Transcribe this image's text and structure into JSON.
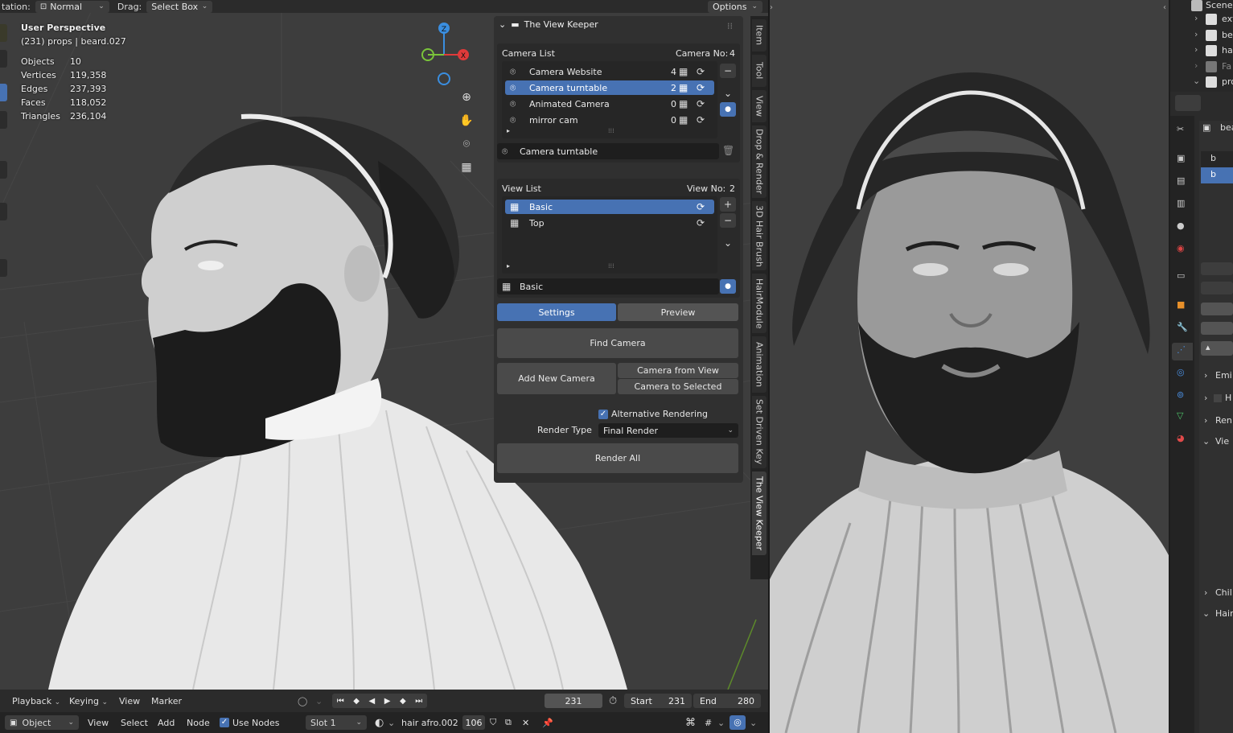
{
  "topbar": {
    "orientation_label": "tation:",
    "orientation_value": "Normal",
    "drag_label": "Drag:",
    "drag_value": "Select Box",
    "options_label": "Options"
  },
  "stats": {
    "perspective": "User Perspective",
    "selection": "(231) props | beard.027",
    "rows": [
      {
        "label": "Objects",
        "value": "10"
      },
      {
        "label": "Vertices",
        "value": "119,358"
      },
      {
        "label": "Edges",
        "value": "237,393"
      },
      {
        "label": "Faces",
        "value": "118,052"
      },
      {
        "label": "Triangles",
        "value": "236,104"
      }
    ]
  },
  "gizmo": {
    "z": "Z",
    "x": "X"
  },
  "panel": {
    "title": "The View Keeper",
    "camera_list_label": "Camera List",
    "camera_no_label": "Camera No:",
    "camera_no": "4",
    "cameras": [
      {
        "name": "Camera Website",
        "count": "4"
      },
      {
        "name": "Camera turntable",
        "count": "2"
      },
      {
        "name": "Animated Camera",
        "count": "0"
      },
      {
        "name": "mirror cam",
        "count": "0"
      }
    ],
    "camera_field": "Camera turntable",
    "view_list_label": "View List",
    "view_no_label": "View No:",
    "view_no": "2",
    "views": [
      {
        "name": "Basic"
      },
      {
        "name": "Top"
      }
    ],
    "view_field": "Basic",
    "tab_settings": "Settings",
    "tab_preview": "Preview",
    "find_camera": "Find Camera",
    "add_new_camera": "Add New Camera",
    "camera_from_view": "Camera from View",
    "camera_to_selected": "Camera to Selected",
    "alt_rendering": "Alternative Rendering",
    "render_type_label": "Render Type",
    "render_type_value": "Final Render",
    "render_all": "Render All"
  },
  "side_tabs": [
    "Item",
    "Tool",
    "View",
    "Drop & Render",
    "3D Hair Brush",
    "HairModule",
    "Animation",
    "Set Driven Key",
    "The View Keeper"
  ],
  "timeline": {
    "playback": "Playback",
    "keying": "Keying",
    "view": "View",
    "marker": "Marker",
    "current_frame": "231",
    "start_label": "Start",
    "start": "231",
    "end_label": "End",
    "end": "280"
  },
  "nodebar": {
    "mode": "Object",
    "view": "View",
    "select": "Select",
    "add": "Add",
    "node": "Node",
    "use_nodes": "Use Nodes",
    "slot": "Slot 1",
    "material": "hair afro.002",
    "users": "106"
  },
  "outliner": {
    "items": [
      "Scene",
      "ext",
      "be",
      "ha",
      "Fa",
      "pro"
    ],
    "prop_header": "bea",
    "prop_items": [
      "b",
      "b"
    ],
    "sections": [
      "Emi",
      "H",
      "Ren",
      "Vie",
      "Chil",
      "Hair"
    ]
  },
  "colors": {
    "accent": "#4772b3",
    "panel": "#303030",
    "viewport": "#3d3d3d",
    "axis_x": "#e03a3a",
    "axis_y": "#7ac43a",
    "axis_z": "#3a8ee0"
  }
}
